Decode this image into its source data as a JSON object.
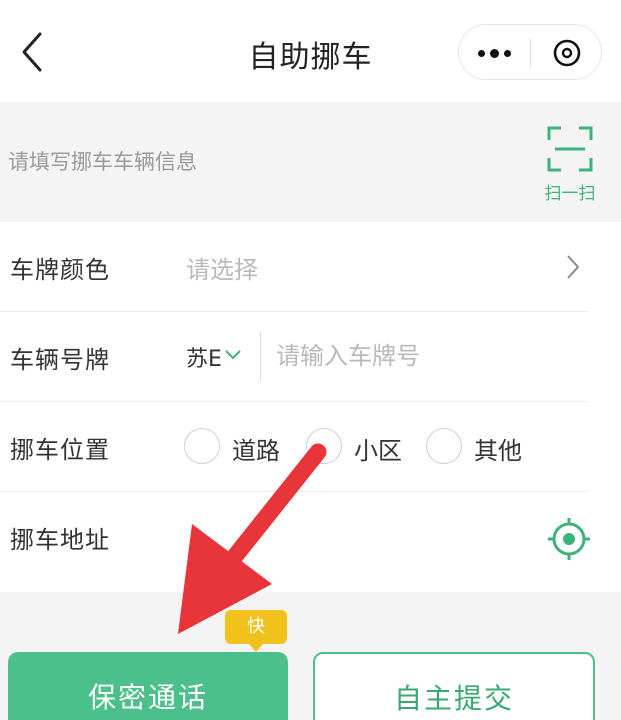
{
  "header": {
    "title": "自助挪车",
    "back_icon": "back-chevron-icon",
    "more_icon": "more-dots-icon",
    "close_icon": "close-circle-icon"
  },
  "info_bar": {
    "placeholder": "请填写挪车车辆信息",
    "scan_label": "扫一扫",
    "scan_icon": "scan-frame-icon"
  },
  "form": {
    "plate_color": {
      "label": "车牌颜色",
      "value_placeholder": "请选择"
    },
    "plate_number": {
      "label": "车辆号牌",
      "prefix": "苏E",
      "placeholder": "请输入车牌号"
    },
    "location": {
      "label": "挪车位置",
      "options": [
        "道路",
        "小区",
        "其他"
      ]
    },
    "address": {
      "label": "挪车地址",
      "locate_icon": "locate-target-icon"
    }
  },
  "actions": {
    "badge": "快",
    "secure_call": "保密通话",
    "self_submit": "自主提交"
  },
  "colors": {
    "accent": "#4cc08a",
    "badge": "#f2c21c",
    "annotation_arrow": "#e8353a"
  }
}
